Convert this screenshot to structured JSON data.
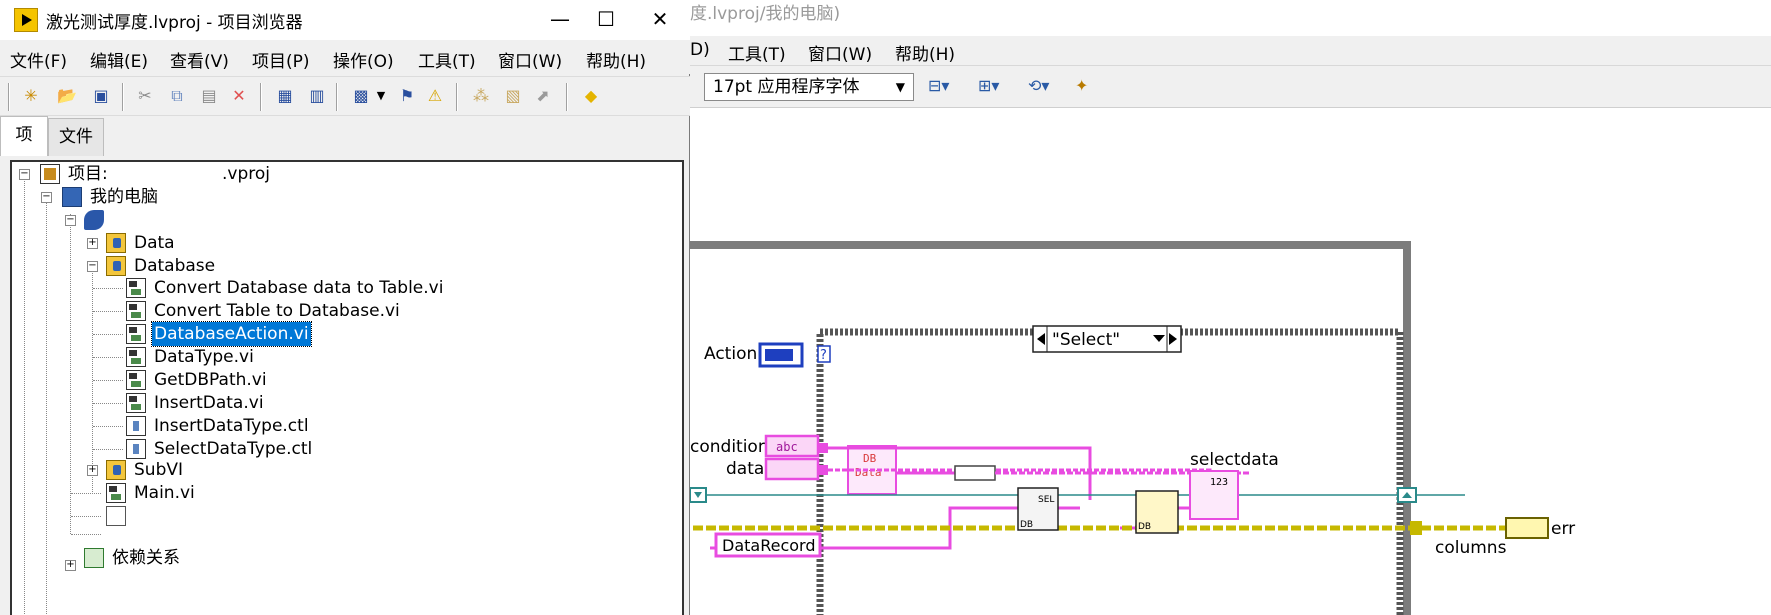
{
  "background_window": {
    "title": "度.lvproj/我的电脑)",
    "menu": [
      "D)",
      "工具(T)",
      "窗口(W)",
      "帮助(H)"
    ],
    "font_select": "17pt 应用程序字体",
    "case_selector": "\"Select\"",
    "labels": {
      "action": "Action",
      "condition": "condition",
      "data": "data",
      "selectdata": "selectdata",
      "db_data_line1": "DB",
      "db_data_line2": "Data",
      "db_record": "DataRecord",
      "columns": "columns",
      "err": "err",
      "abc": "abc",
      "num": "123",
      "q": "?",
      "sel": "SEL",
      "db": "DB"
    },
    "colors": {
      "pink_wire": "#e84ce0",
      "teal_wire": "#2a8a8a",
      "yellow_wire": "#c6b800",
      "blue_enum": "#1e3fbf"
    }
  },
  "project_window": {
    "title": "激光测试厚度.lvproj - 项目浏览器",
    "window_buttons": [
      "—",
      "☐",
      "✕"
    ],
    "menu": [
      "文件(F)",
      "编辑(E)",
      "查看(V)",
      "项目(P)",
      "操作(O)",
      "工具(T)",
      "窗口(W)",
      "帮助(H)"
    ],
    "tabs": [
      "项",
      "文件"
    ],
    "tree": [
      {
        "label": "项目:",
        "suffix": ".vproj",
        "icon": "project-icon"
      },
      {
        "label": "我的电脑",
        "icon": "computer-icon"
      },
      {
        "label": "",
        "icon": "target-icon"
      },
      {
        "label": "Data",
        "icon": "folder-icon"
      },
      {
        "label": "Database",
        "icon": "folder-icon"
      },
      {
        "label": "Convert Database data to Table.vi",
        "icon": "vi-icon"
      },
      {
        "label": "Convert Table  to Database.vi",
        "icon": "vi-icon"
      },
      {
        "label": "DatabaseAction.vi",
        "icon": "vi-icon",
        "selected": true
      },
      {
        "label": "DataType.vi",
        "icon": "vi-icon"
      },
      {
        "label": "GetDBPath.vi",
        "icon": "vi-icon"
      },
      {
        "label": "InsertData.vi",
        "icon": "vi-icon"
      },
      {
        "label": "InsertDataType.ctl",
        "icon": "control-icon"
      },
      {
        "label": "SelectDataType.ctl",
        "icon": "control-icon"
      },
      {
        "label": "SubVI",
        "icon": "folder-icon"
      },
      {
        "label": "Main.vi",
        "icon": "vi-icon"
      },
      {
        "label": "",
        "icon": "file-icon"
      },
      {
        "label": "",
        "icon": "file-icon"
      },
      {
        "label": "依赖关系",
        "icon": "dependencies-icon"
      }
    ]
  }
}
